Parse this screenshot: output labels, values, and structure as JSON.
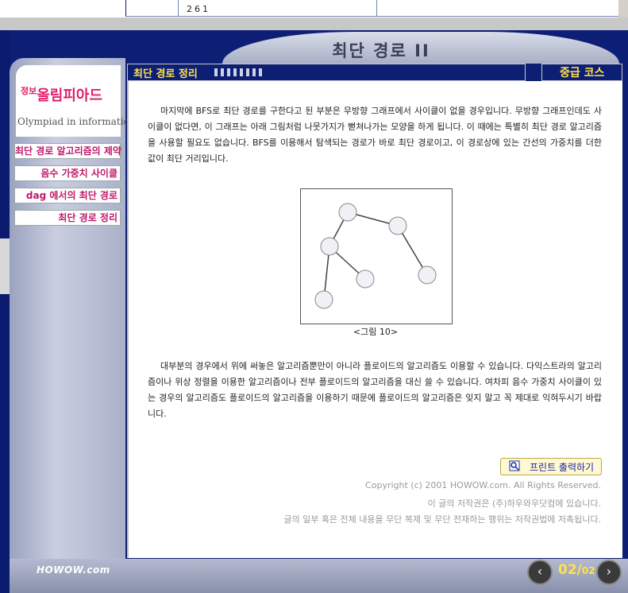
{
  "top_table": {
    "value": "261"
  },
  "header": {
    "title": "최단 경로 II"
  },
  "logo": {
    "kr_small": "정보",
    "kr_main": "올림피아드",
    "en": "Olympiad in informatics"
  },
  "sidebar": {
    "items": [
      {
        "label": "최단 경로 알고리즘의 제약"
      },
      {
        "label": "음수 가중치 사이클"
      },
      {
        "label": "dag 에서의 최단 경로"
      },
      {
        "label": "최단 경로 정리"
      }
    ]
  },
  "section": {
    "title": "최단 경로 정리",
    "course": "중급 코스"
  },
  "content": {
    "paragraph1": "마지막에 BFS로 최단 경로를 구한다고 된 부분은 무방향 그래프에서 사이클이 없을 경우입니다. 무방향 그래프인데도 사이클이 없다면, 이 그래프는 아래 그림처럼 나뭇가지가 뻗쳐나가는 모양을 하게 됩니다. 이 때에는 특별히 최단 경로 알고리즘을 사용할 필요도 없습니다. BFS를 이용해서 탐색되는 경로가 바로 최단 경로이고, 이 경로상에 있는 간선의 가중치를 더한 값이 최단 거리입니다.",
    "figure_caption": "<그림 10>",
    "paragraph2": "대부분의 경우에서 위에 써놓은 알고리즘뿐만이 아니라 플로이드의 알고리즘도 이용할 수 있습니다. 다익스트라의 알고리즘이나 위상 정렬을 이용한 알고리즘이나 전부 플로이드의 알고리즘을 대신 쓸 수 있습니다. 여차피 음수 가중치 사이클이 있는 경우의 알고리즘도 플로이드의 알고리즘을 이용하기 때문에 플로이드의 알고리즘은 잊지 말고 꼭 제대로 익혀두시기 바랍니다."
  },
  "print_button": {
    "label": "프린트 출력하기",
    "icon": "magnifier-print-icon"
  },
  "copyright": {
    "line1": "Copyright (c) 2001 HOWOW.com. All Rights Reserved.",
    "line2": "이 글의 저작권은 (주)하우와우닷컴에 있습니다.",
    "line3": "글의 일부 혹은 전체 내용을 무단 복제 및 무단 전재하는 행위는 저작권법에 저촉됩니다."
  },
  "footer": {
    "brand": "HOWOW.com",
    "page_current": "02",
    "page_separator": "/",
    "page_total": "02"
  },
  "colors": {
    "frame": "#0d1f75",
    "accent_yellow": "#ffe24a",
    "nav_pink": "#c0186a"
  }
}
